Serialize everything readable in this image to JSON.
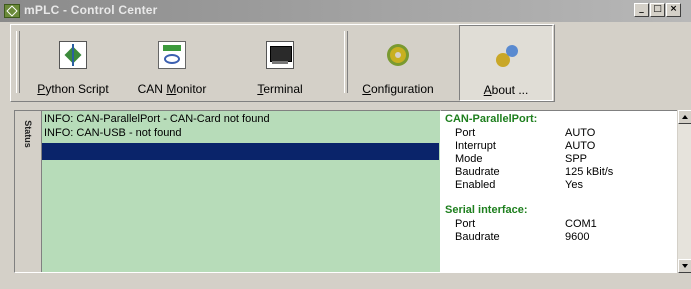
{
  "window": {
    "title": "mPLC - Control Center",
    "controls": [
      "_",
      "□",
      "×"
    ]
  },
  "toolbar": {
    "buttons": [
      {
        "label": "Python Script",
        "accel": "P",
        "icon": "python-script-icon"
      },
      {
        "label": "CAN Monitor",
        "accel": "M",
        "icon": "can-monitor-icon"
      },
      {
        "label": "Terminal",
        "accel": "T",
        "icon": "terminal-icon"
      },
      {
        "label": "Configuration",
        "accel": "C",
        "icon": "configuration-gear-icon"
      },
      {
        "label": "About ...",
        "accel": "A",
        "icon": "about-icon"
      }
    ]
  },
  "log": {
    "tab_label": "Status",
    "lines": [
      "INFO: CAN-ParallelPort - CAN-Card not found",
      "INFO: CAN-USB - not found"
    ]
  },
  "info": {
    "sections": [
      {
        "title": "CAN-ParallelPort:",
        "rows": [
          {
            "key": "Port",
            "value": "AUTO"
          },
          {
            "key": "Interrupt",
            "value": "AUTO"
          },
          {
            "key": "Mode",
            "value": "SPP"
          },
          {
            "key": "Baudrate",
            "value": "125 kBit/s"
          },
          {
            "key": "Enabled",
            "value": "Yes"
          }
        ]
      },
      {
        "title": "Serial interface:",
        "rows": [
          {
            "key": "Port",
            "value": "COM1"
          },
          {
            "key": "Baudrate",
            "value": "9600"
          }
        ]
      }
    ]
  },
  "colors": {
    "log_background": "#b7dcb9",
    "selection": "#0a246a",
    "section_title": "#1e7f1e"
  }
}
